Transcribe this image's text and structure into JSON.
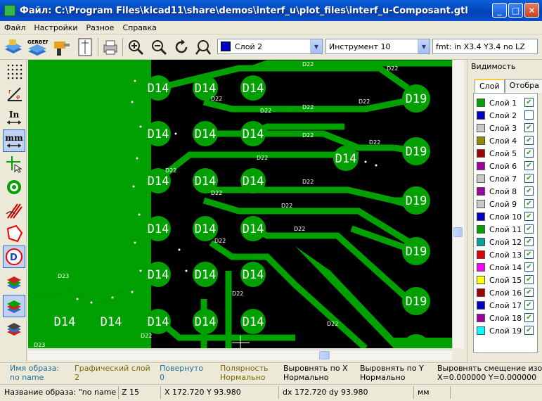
{
  "window": {
    "title": "Файл: C:\\Program Files\\kicad11\\share\\demos\\interf_u\\plot_files\\interf_u-Composant.gtl"
  },
  "menu": [
    "Файл",
    "Настройки",
    "Разное",
    "Справка"
  ],
  "toolbar": {
    "gerber_label": "GERBER",
    "layer_combo": "Слой 2",
    "tool_combo": "Инструмент 10",
    "fmt_text": "fmt: in X3.4 Y3.4 no LZ"
  },
  "left_tools": {
    "units_in": "In",
    "units_mm": "mm"
  },
  "canvas": {
    "pad_label_big": "D14",
    "pad_label_right": "D19",
    "track_label": "D22",
    "region_label": "D23",
    "track_labels": [
      "D22",
      "D22",
      "D22",
      "D22",
      "D22",
      "D22",
      "D22",
      "D22",
      "D22",
      "D22",
      "D22",
      "D22",
      "D22",
      "D22",
      "D22",
      "D22",
      "D22",
      "D22"
    ],
    "colors": {
      "copper": "#00a000",
      "background": "#000000",
      "text": "#ffffff"
    }
  },
  "right_panel": {
    "title": "Видимость",
    "tabs": [
      "Слой",
      "Отобра"
    ],
    "layers": [
      {
        "name": "Слой 1",
        "color": "#00a000",
        "checked": true
      },
      {
        "name": "Слой 2",
        "color": "#0000c8",
        "checked": false
      },
      {
        "name": "Слой 3",
        "color": "#c8c8c8",
        "checked": true
      },
      {
        "name": "Слой 4",
        "color": "#8c8c00",
        "checked": true
      },
      {
        "name": "Слой 5",
        "color": "#a00000",
        "checked": true
      },
      {
        "name": "Слой 6",
        "color": "#a000a0",
        "checked": true
      },
      {
        "name": "Слой 7",
        "color": "#c8c8c8",
        "checked": true
      },
      {
        "name": "Слой 8",
        "color": "#a000a0",
        "checked": true
      },
      {
        "name": "Слой 9",
        "color": "#c8c8c8",
        "checked": true
      },
      {
        "name": "Слой 10",
        "color": "#0000c8",
        "checked": true
      },
      {
        "name": "Слой 11",
        "color": "#00a000",
        "checked": true
      },
      {
        "name": "Слой 12",
        "color": "#00a0a0",
        "checked": true
      },
      {
        "name": "Слой 13",
        "color": "#e00000",
        "checked": true
      },
      {
        "name": "Слой 14",
        "color": "#ff00ff",
        "checked": true
      },
      {
        "name": "Слой 15",
        "color": "#ffff00",
        "checked": true
      },
      {
        "name": "Слой 16",
        "color": "#a00000",
        "checked": true
      },
      {
        "name": "Слой 17",
        "color": "#0000c8",
        "checked": true
      },
      {
        "name": "Слой 18",
        "color": "#a000a0",
        "checked": true
      },
      {
        "name": "Слой 19",
        "color": "#00ffff",
        "checked": true
      }
    ]
  },
  "info_panel": {
    "image_name_label": "Имя образа:",
    "image_name_value": "no name",
    "graphic_layer_label": "Графический слой",
    "graphic_layer_value": "2",
    "rotated_label": "Повернуто",
    "rotated_value": "0",
    "polarity_label": "Полярность",
    "polarity_value": "Нормально",
    "align_x_label": "Выровнять по X",
    "align_x_value": "Нормально",
    "align_y_label": "Выровнять по Y",
    "align_y_value": "Нормально",
    "offset_label": "Выровнять смещение изобр",
    "offset_value": "X=0.000000 Y=0.000000"
  },
  "statusbar": {
    "image_name": "Название образа: \"no name\"  Ha",
    "zoom": "Z 15",
    "xy": "X 172.720  Y 93.980",
    "dxdy": "dx 172.720  dy 93.980",
    "units": "мм"
  }
}
